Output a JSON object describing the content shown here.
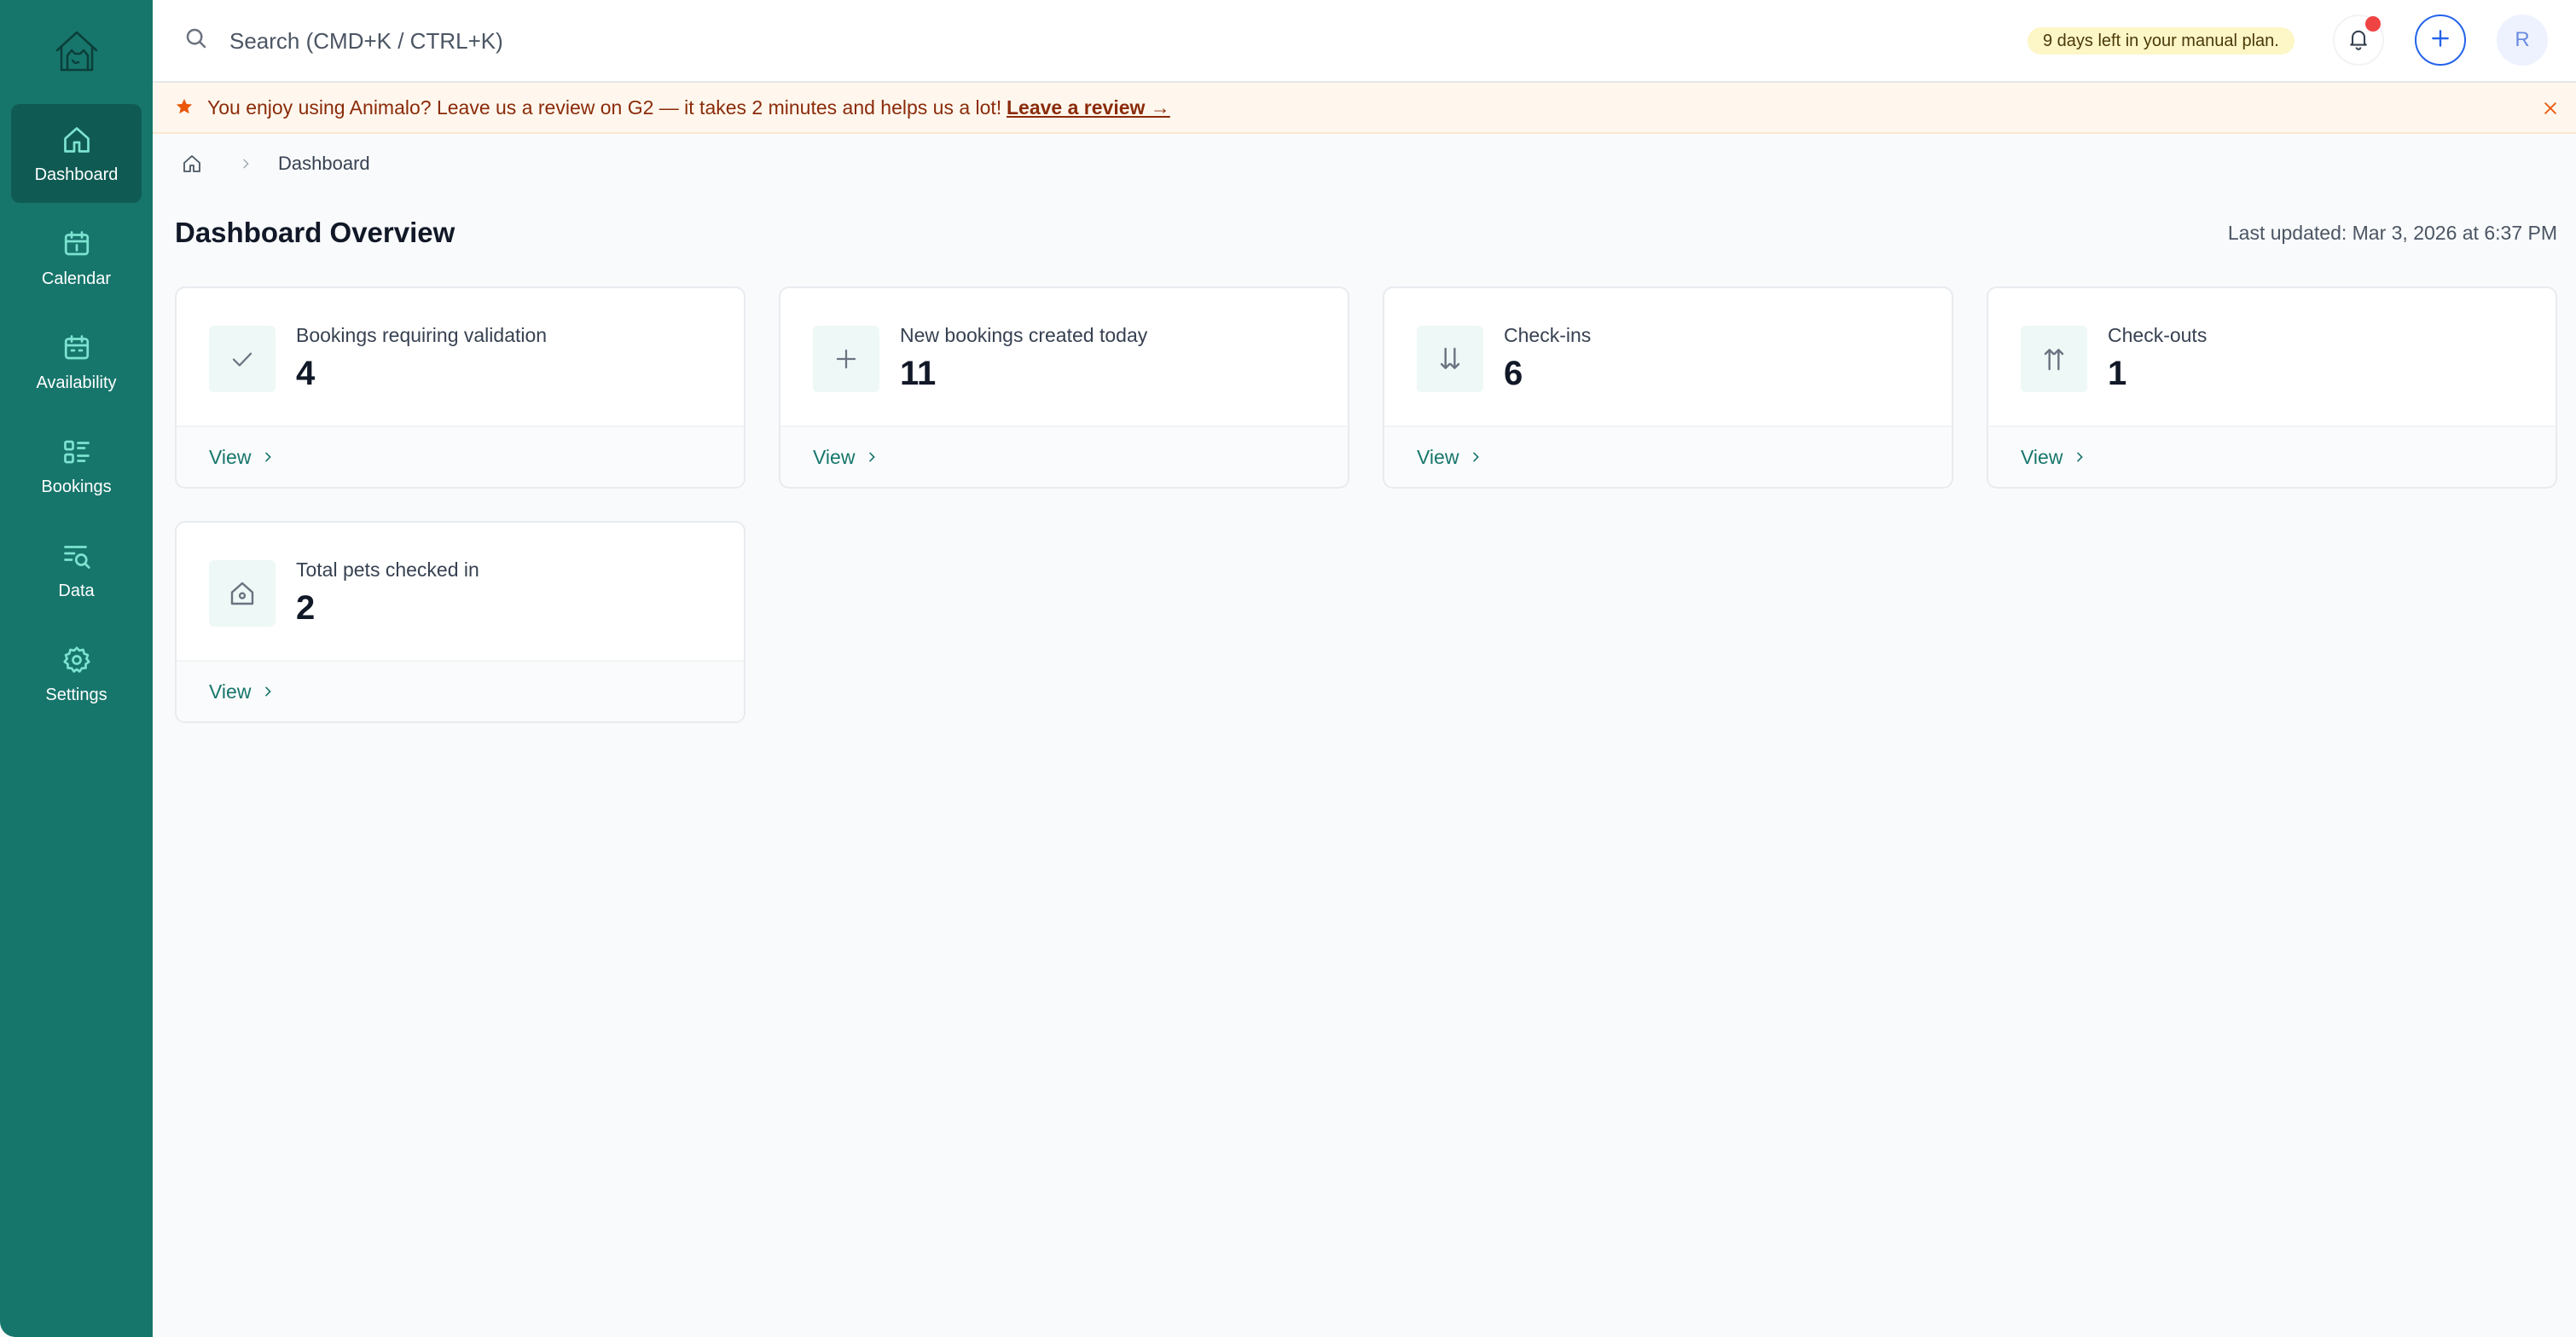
{
  "sidebar": {
    "logo": "house-pet-logo",
    "items": [
      {
        "label": "Dashboard",
        "icon": "home-icon",
        "active": true
      },
      {
        "label": "Calendar",
        "icon": "calendar-icon",
        "active": false
      },
      {
        "label": "Availability",
        "icon": "calendar-availability-icon",
        "active": false
      },
      {
        "label": "Bookings",
        "icon": "list-icon",
        "active": false
      },
      {
        "label": "Data",
        "icon": "data-search-icon",
        "active": false
      },
      {
        "label": "Settings",
        "icon": "gear-icon",
        "active": false
      }
    ]
  },
  "topbar": {
    "search_placeholder": "Search (CMD+K / CTRL+K)",
    "trial_badge": "9 days left in your manual plan.",
    "avatar_initial": "R"
  },
  "banner": {
    "text": "You enjoy using Animalo? Leave us a review on G2 — it takes 2 minutes and helps us a lot!",
    "link": "Leave a review →"
  },
  "breadcrumb": {
    "current": "Dashboard"
  },
  "main": {
    "title": "Dashboard Overview",
    "last_updated": "Last updated: Mar 3, 2026 at 6:37 PM",
    "cards": [
      {
        "label": "Bookings requiring validation",
        "value": "4",
        "icon": "check-icon",
        "view": "View"
      },
      {
        "label": "New bookings created today",
        "value": "11",
        "icon": "plus-icon",
        "view": "View"
      },
      {
        "label": "Check-ins",
        "value": "6",
        "icon": "arrows-down-icon",
        "view": "View"
      },
      {
        "label": "Check-outs",
        "value": "1",
        "icon": "arrows-up-icon",
        "view": "View"
      },
      {
        "label": "Total pets checked in",
        "value": "2",
        "icon": "house-icon",
        "view": "View"
      }
    ]
  },
  "colors": {
    "sidebar": "#17766c",
    "sidebar_active": "#0f5b53",
    "accent": "#17766c",
    "banner_bg": "#fff7ed",
    "banner_text": "#8a2b0a",
    "badge_bg": "#fdf6c7",
    "notification_dot": "#ef4444",
    "plus_button": "#2563eb"
  }
}
